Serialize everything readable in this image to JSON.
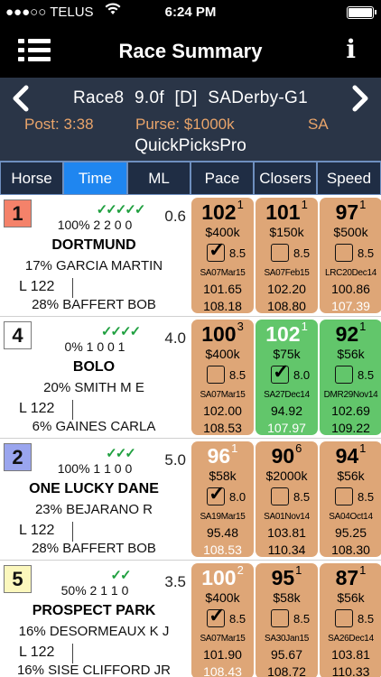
{
  "status_bar": {
    "carrier": "●●●○○ TELUS",
    "time": "6:24 PM"
  },
  "nav": {
    "title": "Race Summary",
    "info_label": "i"
  },
  "race": {
    "race": "Race8",
    "distance": "9.0f",
    "surface": "[D]",
    "name": "SADerby-G1",
    "post": "Post: 3:38",
    "purse": "Purse: $1000k",
    "track": "SA",
    "app_name": "QuickPicksPro",
    "prev_arrow": "‹",
    "next_arrow": "›"
  },
  "tabs": [
    {
      "label": "Horse",
      "active": false
    },
    {
      "label": "Time",
      "active": true
    },
    {
      "label": "ML",
      "active": false
    },
    {
      "label": "Pace",
      "active": false
    },
    {
      "label": "Closers",
      "active": false
    },
    {
      "label": "Speed",
      "active": false
    }
  ],
  "rows": [
    {
      "pp": "1",
      "pp_color": "#f4826a",
      "checks": "✓✓✓✓✓",
      "stat": "100% 2 2 0 0",
      "ml": "0.6",
      "name": "DORTMUND",
      "jockey": "17% GARCIA MARTIN",
      "weight": "L 122",
      "trainer": "28% BAFFERT BOB",
      "boxes": [
        {
          "fig": "102",
          "sup": "1",
          "purse": "$400k",
          "checked": true,
          "spd": "8.5",
          "date": "SA07Mar15",
          "f1": "101.65",
          "f2": "108.18",
          "color": "orange",
          "fig_white": false,
          "f2_white": false
        },
        {
          "fig": "101",
          "sup": "1",
          "purse": "$150k",
          "checked": false,
          "spd": "8.5",
          "date": "SA07Feb15",
          "f1": "102.20",
          "f2": "108.80",
          "color": "orange",
          "fig_white": false,
          "f2_white": false
        },
        {
          "fig": "97",
          "sup": "1",
          "purse": "$500k",
          "checked": false,
          "spd": "8.5",
          "date": "LRC20Dec14",
          "f1": "100.86",
          "f2": "107.39",
          "color": "orange",
          "fig_white": false,
          "f2_white": true
        }
      ]
    },
    {
      "pp": "4",
      "pp_color": "#ffffff",
      "checks": "✓✓✓✓",
      "stat": "0% 1 0 0 1",
      "ml": "4.0",
      "name": "BOLO",
      "jockey": "20% SMITH M E",
      "weight": "L 122",
      "trainer": "6% GAINES CARLA",
      "boxes": [
        {
          "fig": "100",
          "sup": "3",
          "purse": "$400k",
          "checked": false,
          "spd": "8.5",
          "date": "SA07Mar15",
          "f1": "102.00",
          "f2": "108.53",
          "color": "orange",
          "fig_white": false,
          "f2_white": false
        },
        {
          "fig": "102",
          "sup": "1",
          "purse": "$75k",
          "checked": true,
          "spd": "8.0",
          "date": "SA27Dec14",
          "f1": "94.92",
          "f2": "107.97",
          "color": "green",
          "fig_white": true,
          "f2_white": true
        },
        {
          "fig": "92",
          "sup": "1",
          "purse": "$56k",
          "checked": false,
          "spd": "8.5",
          "date": "DMR29Nov14",
          "f1": "102.69",
          "f2": "109.22",
          "color": "green",
          "fig_white": false,
          "f2_white": false
        }
      ]
    },
    {
      "pp": "2",
      "pp_color": "#9aa5ee",
      "checks": "✓✓✓",
      "stat": "100% 1 1 0 0",
      "ml": "5.0",
      "name": "ONE LUCKY DANE",
      "jockey": "23% BEJARANO R",
      "weight": "L 122",
      "trainer": "28% BAFFERT BOB",
      "boxes": [
        {
          "fig": "96",
          "sup": "1",
          "purse": "$58k",
          "checked": true,
          "spd": "8.0",
          "date": "SA19Mar15",
          "f1": "95.48",
          "f2": "108.53",
          "color": "orange",
          "fig_white": true,
          "f2_white": true
        },
        {
          "fig": "90",
          "sup": "6",
          "purse": "$2000k",
          "checked": false,
          "spd": "8.5",
          "date": "SA01Nov14",
          "f1": "103.81",
          "f2": "110.34",
          "color": "orange",
          "fig_white": false,
          "f2_white": false
        },
        {
          "fig": "94",
          "sup": "1",
          "purse": "$56k",
          "checked": false,
          "spd": "8.5",
          "date": "SA04Oct14",
          "f1": "95.25",
          "f2": "108.30",
          "color": "orange",
          "fig_white": false,
          "f2_white": false
        }
      ]
    },
    {
      "pp": "5",
      "pp_color": "#fbf7bd",
      "checks": "✓✓",
      "stat": "50% 2 1 1 0",
      "ml": "3.5",
      "name": "PROSPECT PARK",
      "jockey": "16% DESORMEAUX K J",
      "weight": "L 122",
      "trainer": "16% SISE CLIFFORD JR",
      "boxes": [
        {
          "fig": "100",
          "sup": "2",
          "purse": "$400k",
          "checked": true,
          "spd": "8.5",
          "date": "SA07Mar15",
          "f1": "101.90",
          "f2": "108.43",
          "color": "orange",
          "fig_white": true,
          "f2_white": true
        },
        {
          "fig": "95",
          "sup": "1",
          "purse": "$58k",
          "checked": false,
          "spd": "8.5",
          "date": "SA30Jan15",
          "f1": "95.67",
          "f2": "108.72",
          "color": "orange",
          "fig_white": false,
          "f2_white": false
        },
        {
          "fig": "87",
          "sup": "1",
          "purse": "$56k",
          "checked": false,
          "spd": "8.5",
          "date": "SA26Dec14",
          "f1": "103.81",
          "f2": "110.33",
          "color": "orange",
          "fig_white": false,
          "f2_white": false
        }
      ]
    }
  ]
}
